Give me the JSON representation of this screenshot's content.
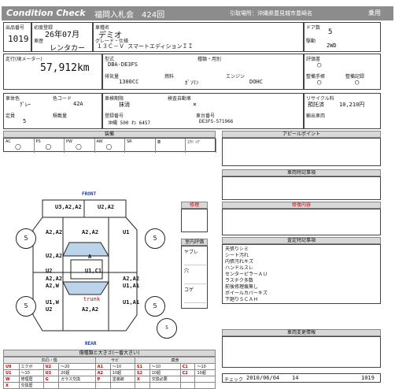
{
  "header": {
    "title": "Condition Check",
    "auction": "福岡入札会",
    "lot_round": "424回",
    "location_label": "引取場所：沖縄県豊見城市豊崎名",
    "right_label": "乗用"
  },
  "row1": {
    "exhibit_no_label": "出品番号",
    "exhibit_no": "1019",
    "first_reg_label": "初度登録",
    "first_reg": "26年07月",
    "usage_label": "車歴",
    "usage": "レンタカー",
    "model_name_label": "車種名",
    "model_name": "デミオ",
    "grade_label": "グレード・仕様",
    "grade": "１３Ｃ－Ｖ スマートエディションＩＩ",
    "doors_label": "ドア数",
    "doors": "5",
    "drive_label": "駆動",
    "drive": "2WD"
  },
  "row2": {
    "mileage_label": "走行(現メーター)",
    "mileage": "57,912km",
    "type_label": "型式",
    "type": "DBA-DE3FS",
    "shift_label": "シフト",
    "shift": "",
    "class_label": "種類・用別",
    "class": "",
    "displacement_label": "排気量",
    "displacement": "1300CC",
    "fuel_label": "燃料",
    "fuel": "ｶﾞｿﾘﾝ",
    "engine_label": "エンジン",
    "engine": "DOHC",
    "ac_label": "評価書",
    "ac": "○",
    "record_label": "整備手帳",
    "record": "○",
    "manual_label": "整備記録",
    "manual": "○"
  },
  "row3": {
    "grade_label": "車体色",
    "grade": "ｸﾞﾚｰ",
    "color_code_label": "色コード",
    "color_code": "42A",
    "inspection_label": "車検期限",
    "inspection": "抹消",
    "self_label": "検査自動車",
    "self": "×",
    "recycle_label": "リサイクル料",
    "recycle": "預託済",
    "recycle_amount": "10,210円",
    "capacity_label": "定員",
    "capacity": "5",
    "load_label": "積載量",
    "load": "",
    "reg_no_label": "登録番号",
    "reg_no": "沖縄  500 わ  6457",
    "chassis_label": "車台番号",
    "chassis": "DE3FS-571966",
    "plate_label": "輸出車両",
    "plate": ""
  },
  "equipment": {
    "title": "装備",
    "cols": [
      "AC",
      "PS",
      "PW",
      "AW",
      "SR",
      "革",
      "ｴｱﾊﾞｯｸﾞ"
    ],
    "vals": [
      "○",
      "○",
      "○",
      "○",
      "",
      "",
      ""
    ]
  },
  "appeal_title": "アピールポイント",
  "special_title": "車両特記事項",
  "repair_title": "修復内容",
  "inspector_title": "査定特記事項",
  "inspector_items": [
    "天張りシミ",
    "シート汚れ",
    "内張汚れキズ",
    "ハンドルスレ",
    "センターピラーＡＵ",
    "ラスチク多数",
    "前後修理痕無し",
    "ボイールカバーキズ",
    "下廻りＳＣＡＨ"
  ],
  "diagram": {
    "front": "FRONT",
    "rear": "REAR",
    "trunk": "trunk",
    "labels": [
      "U3,A2,A2",
      "U2,A2",
      "A2,A2",
      "A2,A2",
      "U1",
      "U2,A2",
      "A",
      "U1,C1",
      "U2",
      "A2,A2",
      "A2,W",
      "A2,A2",
      "U1,A1",
      "U1,A1",
      "U1,W",
      "U2",
      "A2,A2"
    ],
    "wheels": [
      "5",
      "5",
      "5",
      "5",
      "5",
      "5",
      "5",
      "5"
    ],
    "spare": "5"
  },
  "side_panel": {
    "title": "修理",
    "interior_title": "室内評価",
    "items": [
      "ヤブレ",
      "穴",
      "コゲ"
    ]
  },
  "history_title": "車両変更情報",
  "legend": {
    "title": "傷種類と大きさ(一番大きい)",
    "headers": [
      "凹凸・傷",
      "サビ",
      "腐食"
    ],
    "rows": [
      [
        "U9",
        "エクボ",
        "U2",
        "～20",
        "A1",
        "～10",
        "S1",
        "～10",
        "C1",
        "～10"
      ],
      [
        "U1",
        "～10",
        "U3",
        "20超",
        "A2",
        "10超",
        "S2",
        "10超",
        "C2",
        "10超"
      ],
      [
        "W",
        "修理歴",
        "G",
        "ガラス交換",
        "P",
        "塗装跡",
        "X",
        "交換必要",
        "",
        ""
      ],
      [
        "X",
        "交換歴",
        "",
        "",
        "",
        "",
        "",
        "",
        "",
        ""
      ]
    ]
  },
  "footer": {
    "check_label": "チェック",
    "date": "2010/06/04",
    "num": "14",
    "lot": "1019"
  }
}
